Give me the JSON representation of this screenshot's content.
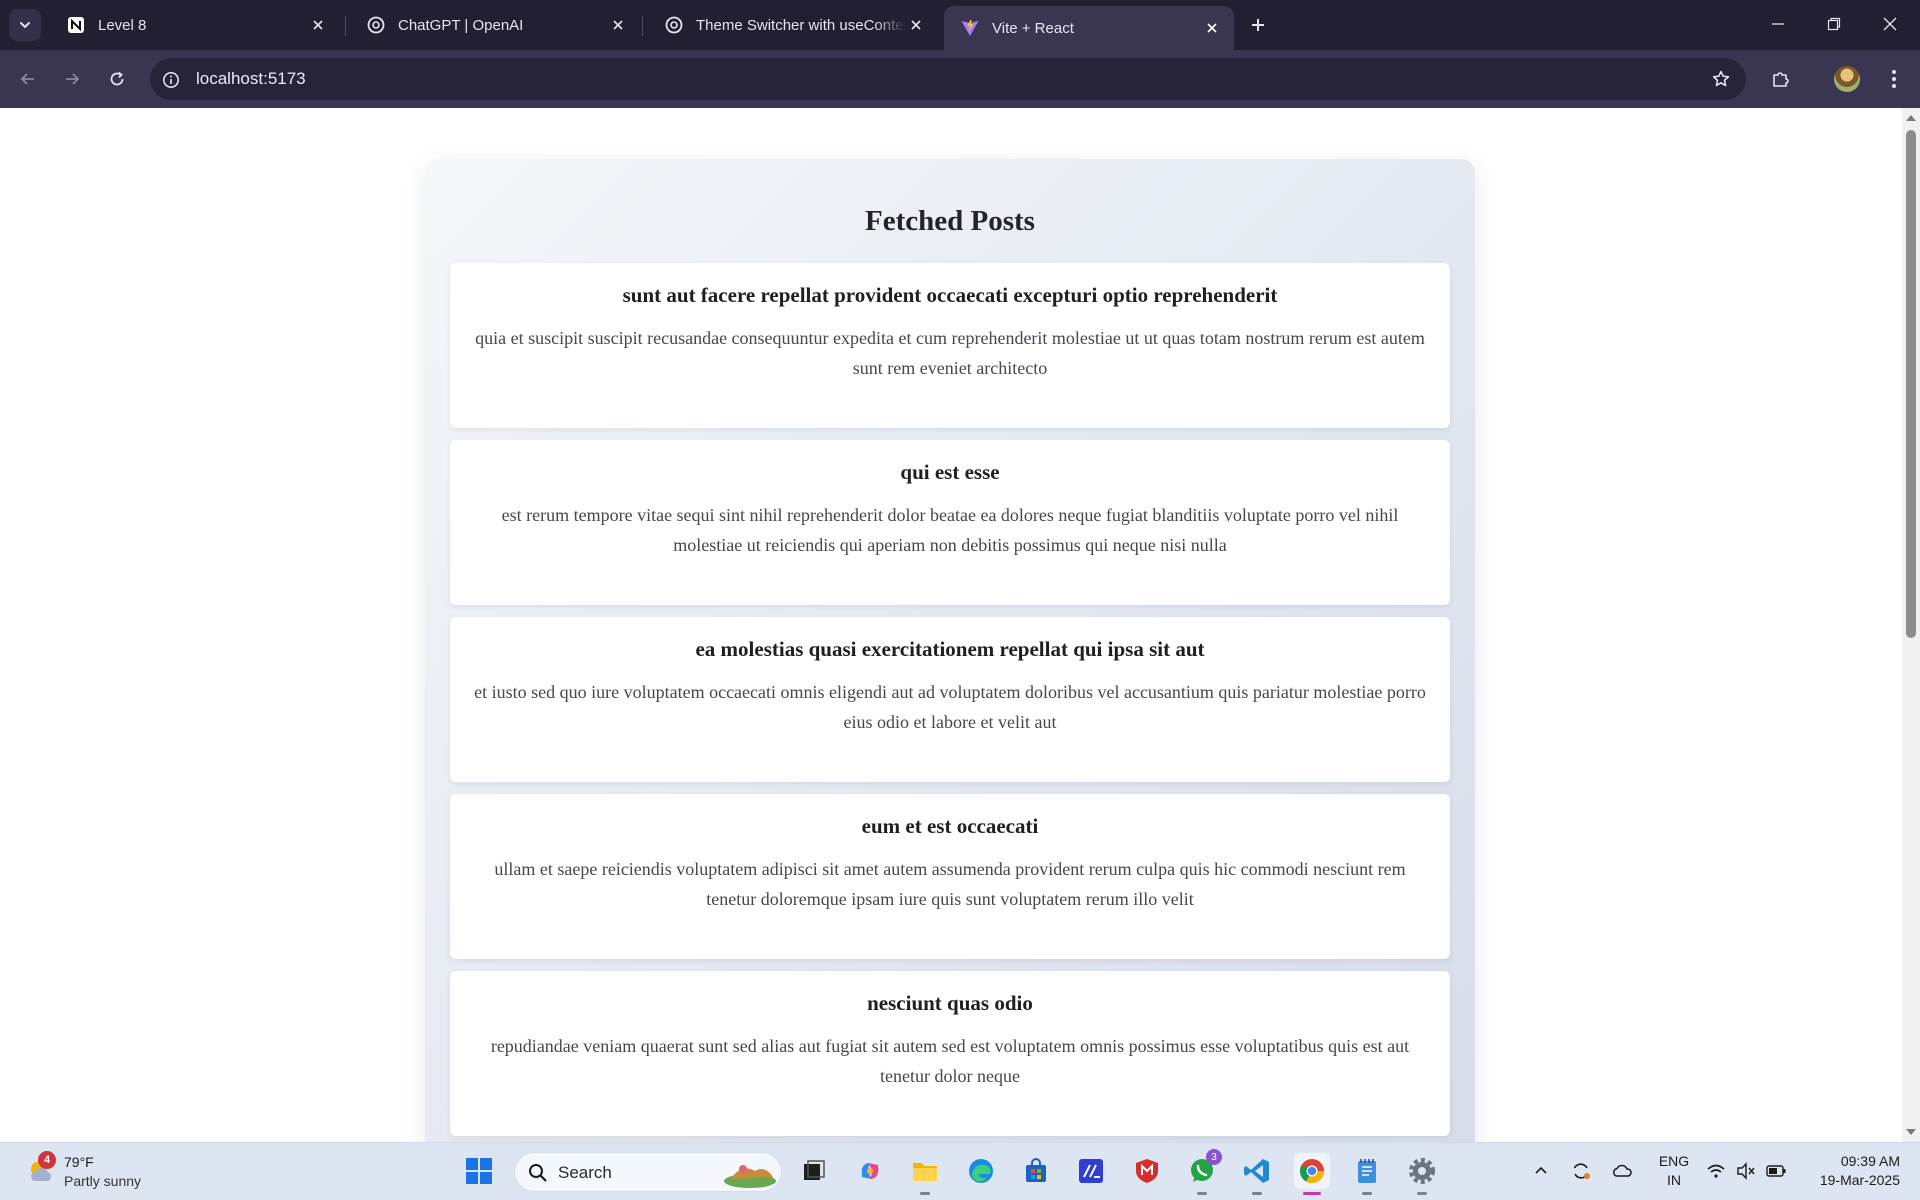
{
  "browser": {
    "tabs": [
      {
        "title": "Level 8",
        "icon": "notion-icon"
      },
      {
        "title": "ChatGPT | OpenAI",
        "icon": "openai-icon"
      },
      {
        "title": "Theme Switcher with useContext",
        "icon": "openai-icon"
      },
      {
        "title": "Vite + React",
        "icon": "vite-icon",
        "active": true
      }
    ],
    "url": "localhost:5173"
  },
  "page": {
    "heading": "Fetched Posts",
    "posts": [
      {
        "title": "sunt aut facere repellat provident occaecati excepturi optio reprehenderit",
        "body": "quia et suscipit suscipit recusandae consequuntur expedita et cum reprehenderit molestiae ut ut quas totam nostrum rerum est autem sunt rem eveniet architecto"
      },
      {
        "title": "qui est esse",
        "body": "est rerum tempore vitae sequi sint nihil reprehenderit dolor beatae ea dolores neque fugiat blanditiis voluptate porro vel nihil molestiae ut reiciendis qui aperiam non debitis possimus qui neque nisi nulla"
      },
      {
        "title": "ea molestias quasi exercitationem repellat qui ipsa sit aut",
        "body": "et iusto sed quo iure voluptatem occaecati omnis eligendi aut ad voluptatem doloribus vel accusantium quis pariatur molestiae porro eius odio et labore et velit aut"
      },
      {
        "title": "eum et est occaecati",
        "body": "ullam et saepe reiciendis voluptatem adipisci sit amet autem assumenda provident rerum culpa quis hic commodi nesciunt rem tenetur doloremque ipsam iure quis sunt voluptatem rerum illo velit"
      },
      {
        "title": "nesciunt quas odio",
        "body": "repudiandae veniam quaerat sunt sed alias aut fugiat sit autem sed est voluptatem omnis possimus esse voluptatibus quis est aut tenetur dolor neque"
      }
    ]
  },
  "taskbar": {
    "weather": {
      "temp": "79°F",
      "desc": "Partly sunny",
      "badge": "4"
    },
    "search_label": "Search",
    "whatsapp_badge": "3",
    "lang_line1": "ENG",
    "lang_line2": "IN",
    "time": "09:39 AM",
    "date": "19-Mar-2025"
  },
  "colors": {
    "tabbar": "#221f33",
    "toolbar": "#3a3652",
    "taskbar": "#dde5f2",
    "container_gradient_start": "#f5f6f9",
    "container_gradient_end": "#d6dde9"
  }
}
